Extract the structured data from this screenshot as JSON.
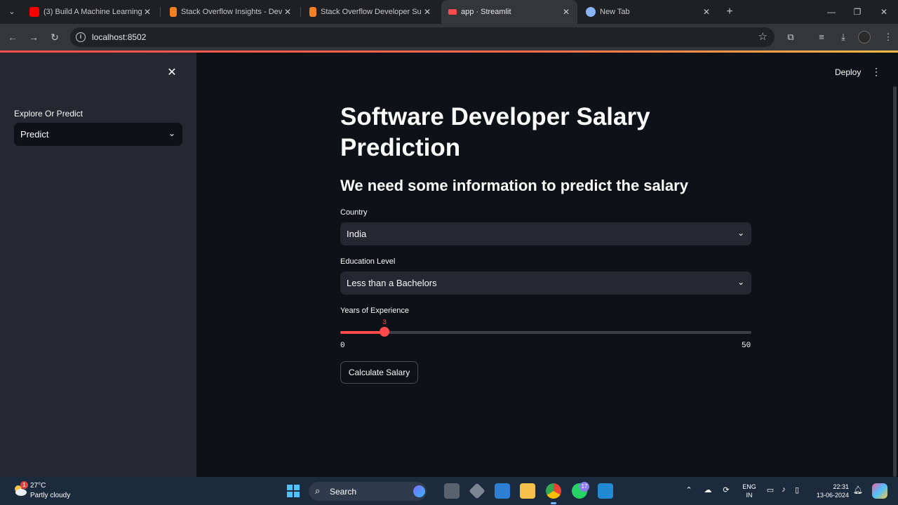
{
  "browser": {
    "tabs": [
      {
        "title": "(3) Build A Machine Learning W",
        "favicon": "youtube-icon",
        "active": false
      },
      {
        "title": "Stack Overflow Insights - Devel",
        "favicon": "stackoverflow-icon",
        "active": false
      },
      {
        "title": "Stack Overflow Developer Surve",
        "favicon": "stackoverflow-icon",
        "active": false
      },
      {
        "title": "app · Streamlit",
        "favicon": "streamlit-icon",
        "active": true
      },
      {
        "title": "New Tab",
        "favicon": "chrome-icon",
        "active": false
      }
    ],
    "url": "localhost:8502"
  },
  "sidebar": {
    "label": "Explore Or Predict",
    "selected": "Predict"
  },
  "header": {
    "deploy_label": "Deploy"
  },
  "main": {
    "title": "Software Developer Salary Prediction",
    "subheader": "We need some information to predict the salary",
    "country": {
      "label": "Country",
      "value": "India"
    },
    "education": {
      "label": "Education Level",
      "value": "Less than a Bachelors"
    },
    "experience": {
      "label": "Years of Experience",
      "value": 3,
      "min": 0,
      "max": 50
    },
    "button_label": "Calculate Salary"
  },
  "taskbar": {
    "weather_badge": "1",
    "temperature": "27°C",
    "condition": "Partly cloudy",
    "search_label": "Search",
    "whatsapp_badge": "17",
    "lang_line1": "ENG",
    "lang_line2": "IN",
    "time": "22:31",
    "date": "13-06-2024"
  },
  "colors": {
    "accent": "#ff4b4b",
    "sidebar_bg": "#262730",
    "main_bg": "#0e1117"
  }
}
